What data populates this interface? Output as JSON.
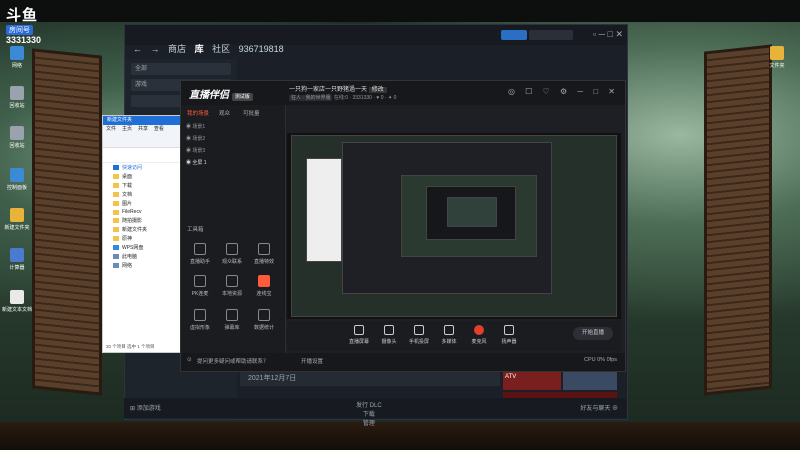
{
  "overlay": {
    "logo_mark": "斗鱼",
    "logo_sub": "房间号",
    "room_number": "3331330"
  },
  "desktop": {
    "left_icons": [
      {
        "label": "网络",
        "color": "#3c8ad6"
      },
      {
        "label": "回收站",
        "color": "#9aa3ad"
      },
      {
        "label": "回收站",
        "color": "#9aa3ad"
      },
      {
        "label": "控制面板",
        "color": "#3c8ad6"
      },
      {
        "label": "新建文件夹",
        "color": "#e8b33a"
      },
      {
        "label": "计算器",
        "color": "#4b7bd1"
      },
      {
        "label": "新建文本文档",
        "color": "#e9e9e9"
      }
    ],
    "right_icon": {
      "label": "文件夹",
      "color": "#e8b33a"
    }
  },
  "steam": {
    "nav_back": "←",
    "nav_forward": "→",
    "nav_store": "商店",
    "nav_library": "库",
    "nav_community": "社区",
    "nav_user": "936719818",
    "side_items": [
      "全部",
      "游戏"
    ],
    "date_label": "2021年12月7日",
    "bottom_left": "添加游戏",
    "bottom_center": "下载",
    "bottom_center_sub": "管理",
    "bottom_right_label": "好友与聊天",
    "promo_text": "of the Wild",
    "promo_sub": "ATV",
    "dlc_label": "发行 DLC"
  },
  "explorer": {
    "title": "新建文件夹",
    "ribbon_tabs": [
      "文件",
      "主页",
      "共享",
      "查看"
    ],
    "quick_access": "快速访问",
    "items": [
      "桌面",
      "下载",
      "文档",
      "图片",
      "FileRecv",
      "随拍摄影",
      "新建文件夹",
      "原神",
      "WPS网盘",
      "此电脑",
      "网络"
    ],
    "status": "30 个项目  选中 1 个项目"
  },
  "live": {
    "app_name": "直播伴侣",
    "badge": "测试版",
    "title": "一只狗一家店一只野猪過一天",
    "title_btn": "修改",
    "tag": "狂人 · 我的世界服",
    "stats": {
      "online": "在线:0",
      "room": "3331330",
      "likes": "0",
      "gifts": "0"
    },
    "tabs": [
      "我的场景",
      "观众",
      "可批量"
    ],
    "scenes": [
      "场景1",
      "场景2",
      "场景3",
      "全屏 1"
    ],
    "toolbox_label": "工具箱",
    "tools": [
      {
        "label": "直播助手",
        "hot": false
      },
      {
        "label": "观众联系",
        "hot": false
      },
      {
        "label": "直播特效",
        "hot": false
      },
      {
        "label": "PK连麦",
        "hot": false
      },
      {
        "label": "本地资源",
        "hot": false
      },
      {
        "label": "连线宝",
        "hot": true
      },
      {
        "label": "虚拟形象",
        "hot": false
      },
      {
        "label": "弹幕库",
        "hot": false
      },
      {
        "label": "数据统计",
        "hot": false
      }
    ],
    "controls": [
      {
        "label": "直播屏幕",
        "active": false
      },
      {
        "label": "摄像头",
        "active": false
      },
      {
        "label": "手机投屏",
        "active": false
      },
      {
        "label": "多媒体",
        "active": false
      },
      {
        "label": "麦克风",
        "active": true
      },
      {
        "label": "扬声器",
        "active": false
      }
    ],
    "start_btn": "开始直播",
    "status_bar": "提问更多疑问或帮助请联系？",
    "status_right": "CPU 0%  0fps",
    "hint": "开播设置"
  }
}
